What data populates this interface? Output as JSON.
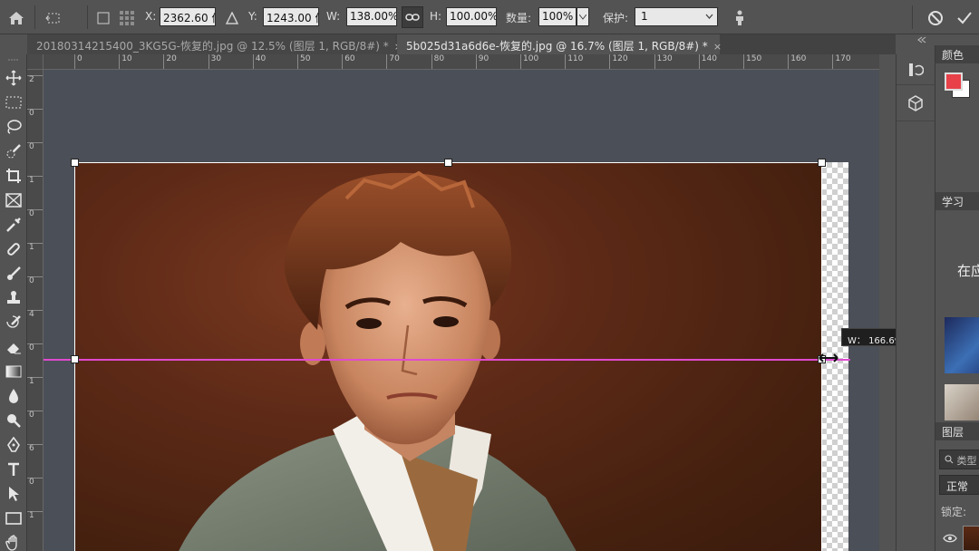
{
  "options_bar": {
    "x_label": "X:",
    "x_value": "2362.60 像",
    "y_label": "Y:",
    "y_value": "1243.00 像",
    "w_label": "W:",
    "w_value": "138.00%",
    "h_label": "H:",
    "h_value": "100.00%",
    "count_label": "数量:",
    "count_value": "100%",
    "protect_label": "保护:",
    "protect_value": "1"
  },
  "tabs": [
    {
      "label": "20180314215400_3KG5G-恢复的.jpg @ 12.5% (图层 1, RGB/8#) *",
      "close": "×",
      "active": false
    },
    {
      "label": "5b025d31a6d6e-恢复的.jpg @ 16.7% (图层 1, RGB/8#) *",
      "close": "×",
      "active": true
    }
  ],
  "ruler_h": [
    "0",
    "10",
    "20",
    "30",
    "40",
    "50",
    "60",
    "70",
    "80",
    "90",
    "100",
    "110",
    "120",
    "130",
    "140",
    "150",
    "160",
    "170"
  ],
  "ruler_v": [
    "2",
    "0",
    "0",
    "1",
    "0",
    "1",
    "0",
    "4",
    "0",
    "1",
    "0",
    "6",
    "0",
    "1"
  ],
  "transform_tooltip": "W： 166.69 厘米",
  "panels": {
    "color_tab": "颜色",
    "learn_tab": "学习",
    "learn_title": "在应",
    "layers_tab": "图层",
    "search_placeholder": "类型",
    "blend_mode": "正常",
    "lock_label": "锁定: "
  },
  "colors": {
    "foreground": "#e8414a",
    "background": "#ffffff",
    "guide": "#e04ad0"
  },
  "icons": {
    "home": "home-icon",
    "move": "move-icon",
    "link": "link-icon",
    "cancel": "cancel-icon",
    "commit": "check-icon"
  }
}
